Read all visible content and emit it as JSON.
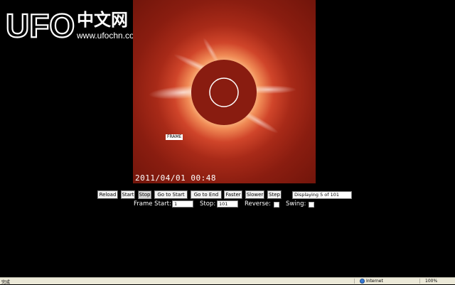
{
  "logo": {
    "brand": "UFO",
    "cn": "中文网",
    "url": "www.ufochn.com"
  },
  "frame": {
    "timestamp": "2011/04/01  00:48",
    "label": "FRAME"
  },
  "controls": {
    "buttons": [
      {
        "label": "Reload"
      },
      {
        "label": "Start"
      },
      {
        "label": "Stop"
      },
      {
        "label": "Go to Start"
      },
      {
        "label": "Go to End"
      },
      {
        "label": "Faster"
      },
      {
        "label": "Slower"
      },
      {
        "label": "Step"
      }
    ],
    "display": "Displaying 5 of 101",
    "frame_start_label": "Frame Start:",
    "frame_start_value": "1",
    "stop_label": "Stop:",
    "stop_value": "101",
    "reverse_label": "Reverse:",
    "swing_label": "Swing:"
  },
  "statusbar": {
    "status": "完成",
    "zone": "Internet",
    "zoom": "100%"
  },
  "colors": {
    "background": "#000000",
    "corona_dark": "#6e140a",
    "corona_light": "#ffe9c8"
  }
}
